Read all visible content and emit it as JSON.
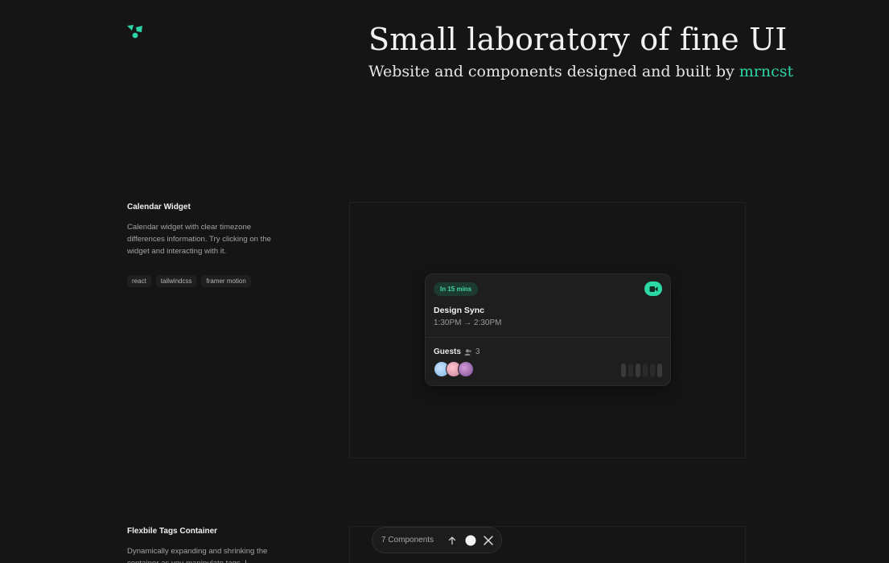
{
  "hero": {
    "title": "Small laboratory of fine UI",
    "subtitle_prefix": "Website and components designed and built by",
    "author": "mrncst"
  },
  "sections": [
    {
      "title": "Calendar Widget",
      "description": "Calendar widget with clear timezone differences information. Try clicking on the widget and interacting with it.",
      "tags": [
        "react",
        "tailwindcss",
        "framer motion"
      ]
    },
    {
      "title": "Flexbile Tags Container",
      "description": "Dynamically expanding and shrinking the container as you manipulate tags. I"
    }
  ],
  "calendar": {
    "badge": "In 15 mins",
    "event_title": "Design Sync",
    "event_time": "1:30PM → 2:30PM",
    "guests_label": "Guests",
    "guests_count": "3",
    "icon": "video-icon",
    "accent": "#2bd8a6"
  },
  "toolbar": {
    "label": "7 Components",
    "icons": [
      "arrow-up-icon",
      "theme-toggle-icon",
      "x-logo-icon"
    ]
  },
  "colors": {
    "background": "#151515",
    "accent": "#2bd4a4"
  }
}
